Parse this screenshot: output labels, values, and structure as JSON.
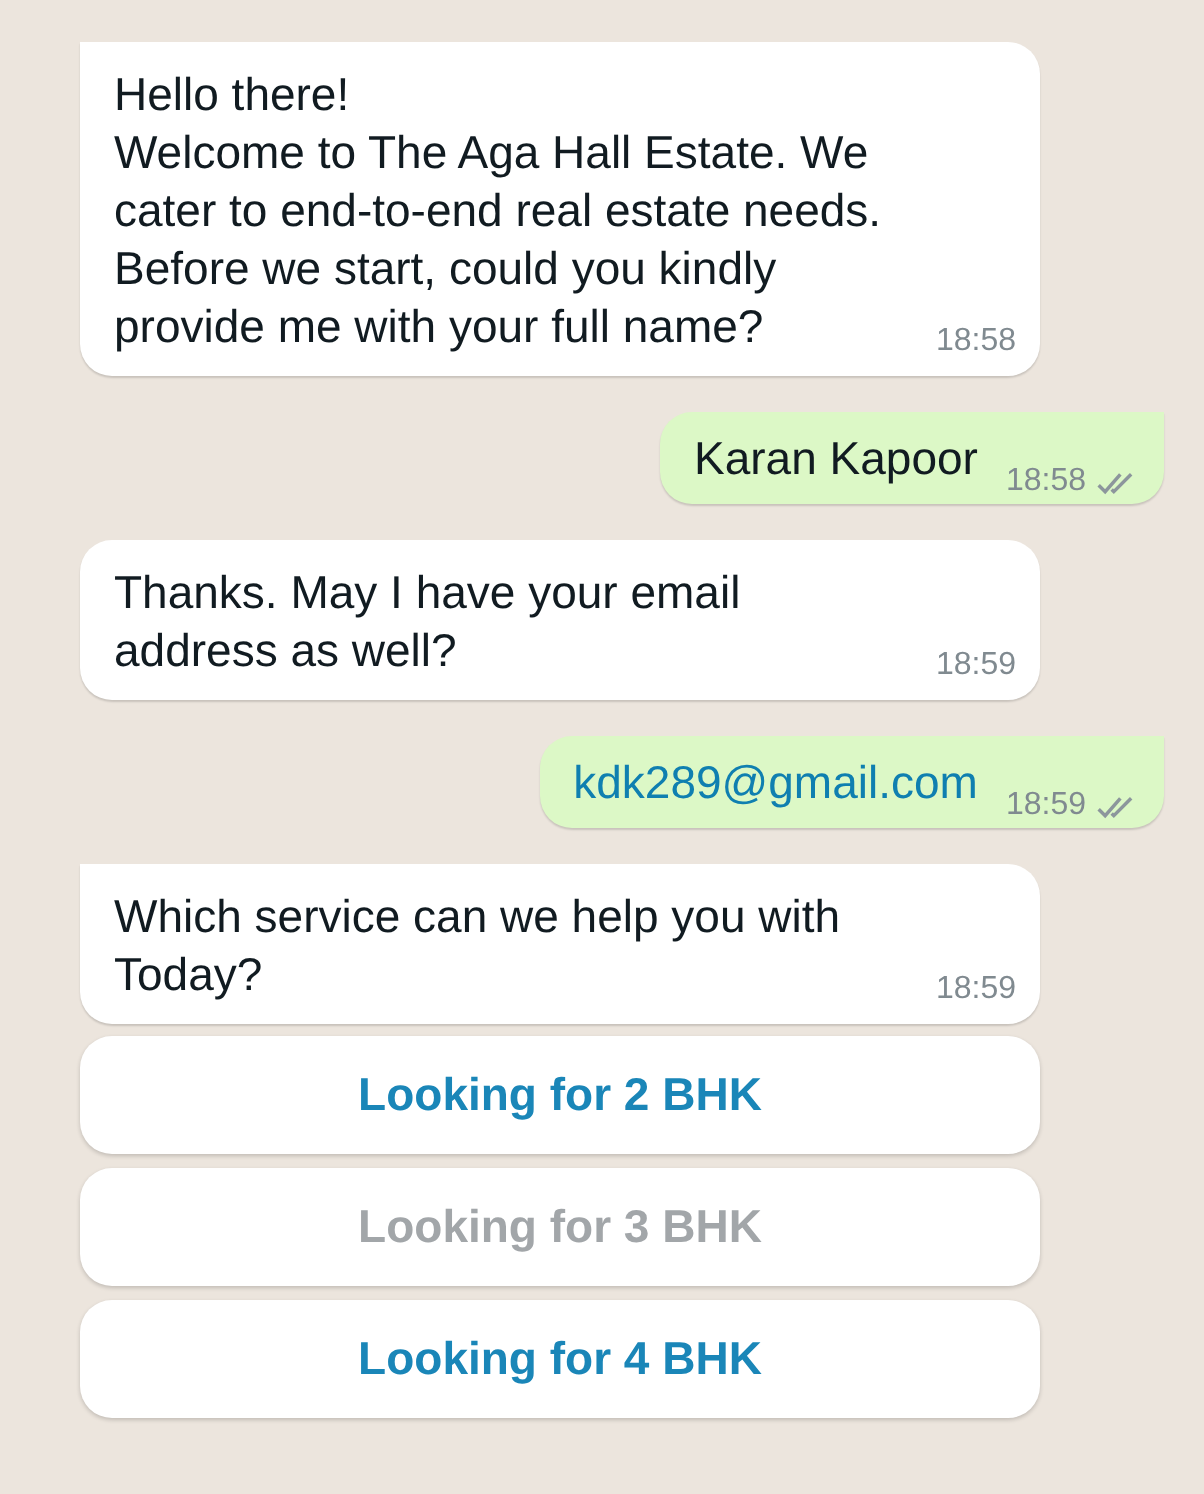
{
  "messages": [
    {
      "kind": "incoming",
      "tail": true,
      "text": "Hello there!\nWelcome to The Aga Hall Estate. We\ncater to end-to-end real estate needs.\nBefore we start, could you kindly\nprovide me with your full name?",
      "time": "18:58"
    },
    {
      "kind": "outgoing",
      "tail": true,
      "text": "Karan Kapoor",
      "link": false,
      "time": "18:58",
      "read": false
    },
    {
      "kind": "incoming",
      "tail": false,
      "text": "Thanks. May I have your email\naddress as well?",
      "time": "18:59"
    },
    {
      "kind": "outgoing",
      "tail": true,
      "text": "kdk289@gmail.com",
      "link": true,
      "time": "18:59",
      "read": false
    },
    {
      "kind": "incoming",
      "tail": true,
      "text": "Which service can we help you with\nToday?",
      "time": "18:59"
    }
  ],
  "quick_replies": [
    {
      "label": "Looking for 2 BHK",
      "disabled": false
    },
    {
      "label": "Looking for 3 BHK",
      "disabled": true
    },
    {
      "label": "Looking for 4 BHK",
      "disabled": false
    }
  ]
}
